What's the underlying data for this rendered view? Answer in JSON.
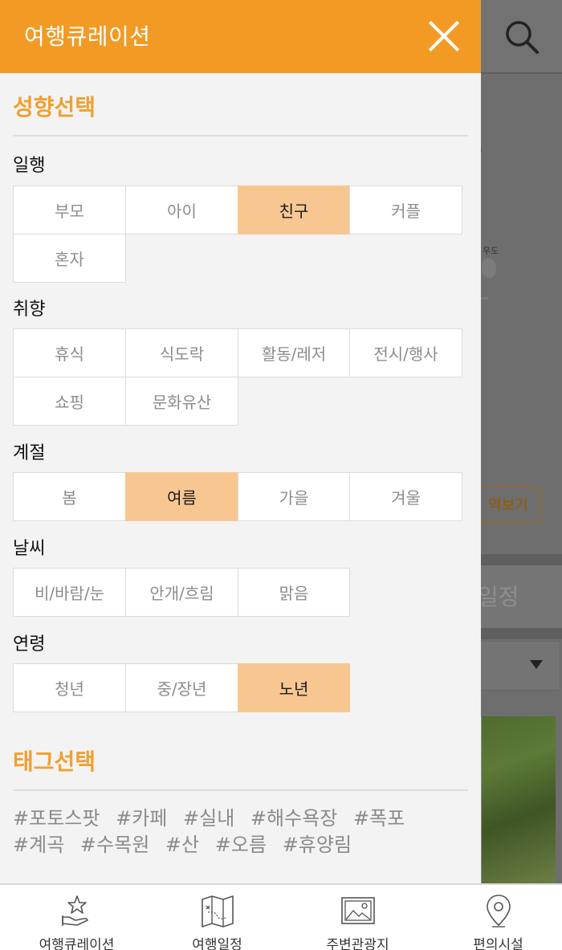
{
  "drawer": {
    "title": "여행큐레이션",
    "preference_title": "성향선택",
    "tag_title": "태그선택"
  },
  "groups": {
    "companion": {
      "label": "일행",
      "options": [
        "부모",
        "아이",
        "친구",
        "커플",
        "혼자"
      ],
      "selected": "친구"
    },
    "taste": {
      "label": "취향",
      "options": [
        "휴식",
        "식도락",
        "활동/레저",
        "전시/행사",
        "쇼핑",
        "문화유산"
      ],
      "selected": ""
    },
    "season": {
      "label": "계절",
      "options": [
        "봄",
        "여름",
        "가을",
        "겨울"
      ],
      "selected": "여름"
    },
    "weather": {
      "label": "날씨",
      "options": [
        "비/바람/눈",
        "안개/흐림",
        "맑음"
      ],
      "selected": ""
    },
    "age": {
      "label": "연령",
      "options": [
        "청년",
        "중/장년",
        "노년"
      ],
      "selected": "노년"
    }
  },
  "tags": [
    "#포토스팟",
    "#카페",
    "#실내",
    "#해수욕장",
    "#폭포",
    "#계곡",
    "#수목원",
    "#산",
    "#오름",
    "#휴양림"
  ],
  "background": {
    "map_label": "우도",
    "button_label": "역보기",
    "tab_label": "일정"
  },
  "bottom_nav": {
    "items": [
      {
        "label": "여행큐레이션",
        "icon": "hand-star-icon"
      },
      {
        "label": "여행일정",
        "icon": "map-icon"
      },
      {
        "label": "주변관광지",
        "icon": "picture-icon"
      },
      {
        "label": "편의시설",
        "icon": "location-pin-icon"
      }
    ]
  },
  "colors": {
    "accent": "#f39a25",
    "selected": "#f8c791",
    "section_title": "#f0a030"
  }
}
